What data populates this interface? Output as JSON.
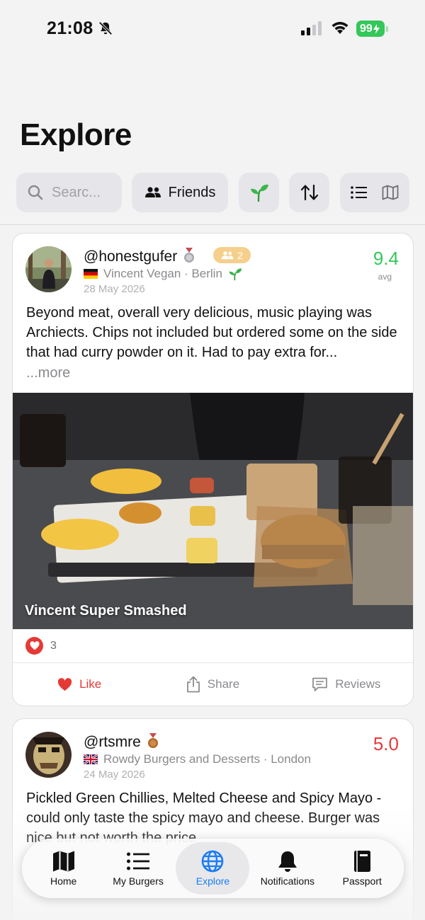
{
  "status_bar": {
    "time": "21:08",
    "battery": "99"
  },
  "header": {
    "title": "Explore"
  },
  "filters": {
    "search_placeholder": "Searc...",
    "friends_label": "Friends"
  },
  "posts": [
    {
      "username": "@honestgufer",
      "group_count": "2",
      "restaurant": "Vincent Vegan · Berlin",
      "date": "28 May 2026",
      "score": "9.4",
      "score_label": "avg",
      "review": "Beyond meat, overall very delicious, music playing was Archiects. Chips not included but ordered some on the side that had curry powder on it. Had to pay extra for...",
      "more_label": "...more",
      "photo_caption": "Vincent Super Smashed",
      "likes": "3",
      "actions": {
        "like": "Like",
        "share": "Share",
        "reviews": "Reviews"
      }
    },
    {
      "username": "@rtsmre",
      "restaurant": "Rowdy Burgers and Desserts · London",
      "date": "24 May 2026",
      "score": "5.0",
      "review": "Pickled Green Chillies, Melted Cheese and Spicy Mayo - could only taste the spicy mayo and cheese. Burger was nice but not worth the price"
    }
  ],
  "tabbar": {
    "tabs": [
      {
        "label": "Home",
        "icon": "map-icon"
      },
      {
        "label": "My Burgers",
        "icon": "list-icon"
      },
      {
        "label": "Explore",
        "icon": "globe-icon",
        "active": true
      },
      {
        "label": "Notifications",
        "icon": "bell-icon"
      },
      {
        "label": "Passport",
        "icon": "book-icon"
      }
    ]
  },
  "colors": {
    "accent": "#1b7cf3",
    "score_high": "#34c759",
    "score_low": "#e63b3b",
    "like": "#e53935"
  }
}
